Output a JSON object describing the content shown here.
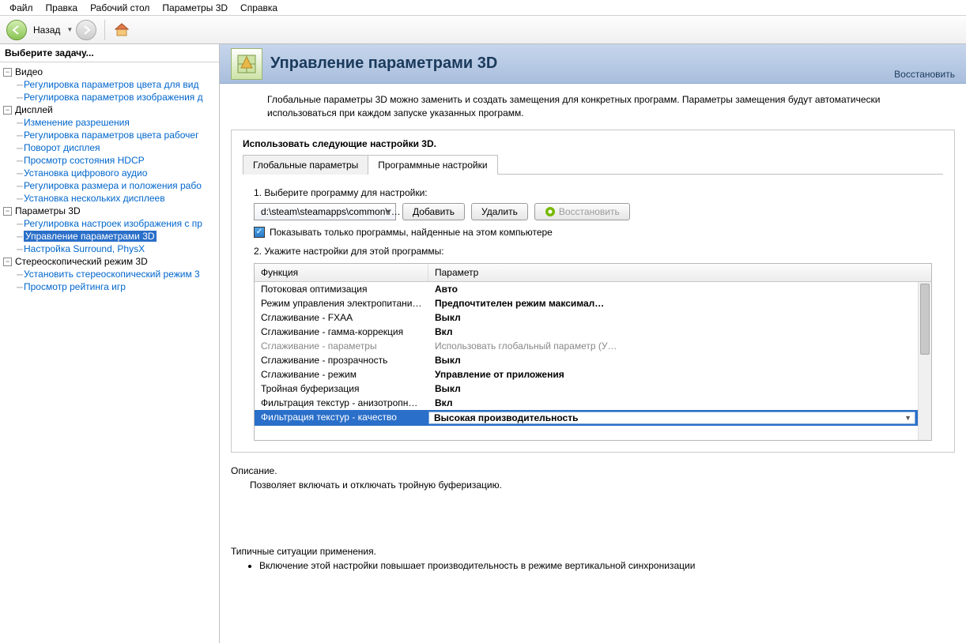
{
  "menu": {
    "file": "Файл",
    "edit": "Правка",
    "desktop": "Рабочий стол",
    "params3d": "Параметры 3D",
    "help": "Справка"
  },
  "nav": {
    "back": "Назад"
  },
  "sidebar": {
    "header": "Выберите задачу...",
    "video": {
      "label": "Видео",
      "items": [
        "Регулировка параметров цвета для вид",
        "Регулировка параметров изображения д"
      ]
    },
    "display": {
      "label": "Дисплей",
      "items": [
        "Изменение разрешения",
        "Регулировка параметров цвета рабочег",
        "Поворот дисплея",
        "Просмотр состояния HDCP",
        "Установка цифрового аудио",
        "Регулировка размера и положения рабо",
        "Установка нескольких дисплеев"
      ]
    },
    "params3d": {
      "label": "Параметры 3D",
      "items": [
        "Регулировка настроек изображения с пр",
        "Управление параметрами 3D",
        "Настройка Surround, PhysX"
      ]
    },
    "stereo": {
      "label": "Стереоскопический режим 3D",
      "items": [
        "Установить стереоскопический режим 3",
        "Просмотр рейтинга игр"
      ]
    }
  },
  "banner": {
    "title": "Управление параметрами 3D",
    "restore": "Восстановить"
  },
  "intro": "Глобальные параметры 3D можно заменить и создать замещения для конкретных программ. Параметры замещения будут автоматически использоваться при каждом запуске указанных программ.",
  "panel": {
    "header": "Использовать следующие настройки 3D.",
    "tabs": {
      "global": "Глобальные параметры",
      "program": "Программные настройки"
    },
    "step1": "1. Выберите программу для настройки:",
    "program_path": "d:\\steam\\steamapps\\common\\r…",
    "add": "Добавить",
    "remove": "Удалить",
    "restore": "Восстановить",
    "checkbox": "Показывать только программы, найденные на этом компьютере",
    "step2": "2. Укажите настройки для этой программы:",
    "col1": "Функция",
    "col2": "Параметр",
    "rows": [
      {
        "f": "Потоковая оптимизация",
        "p": "Авто"
      },
      {
        "f": "Режим управления электропитанием",
        "p": "Предпочтителен режим максимал…"
      },
      {
        "f": "Сглаживание - FXAA",
        "p": "Выкл"
      },
      {
        "f": "Сглаживание - гамма-коррекция",
        "p": "Вкл"
      },
      {
        "f": "Сглаживание - параметры",
        "p": "Использовать глобальный параметр (У…",
        "dis": true
      },
      {
        "f": "Сглаживание - прозрачность",
        "p": "Выкл"
      },
      {
        "f": "Сглаживание - режим",
        "p": "Управление от приложения"
      },
      {
        "f": "Тройная буферизация",
        "p": "Выкл"
      },
      {
        "f": "Фильтрация текстур - анизотропная оп…",
        "p": "Вкл"
      },
      {
        "f": "Фильтрация текстур - качество",
        "p": "Высокая производительность",
        "sel": true
      }
    ]
  },
  "desc": {
    "title": "Описание.",
    "body": "Позволяет включать и отключать тройную буферизацию."
  },
  "usage": {
    "title": "Типичные ситуации применения.",
    "items": [
      "Включение этой настройки повышает производительность в режиме вертикальной синхронизации"
    ]
  }
}
